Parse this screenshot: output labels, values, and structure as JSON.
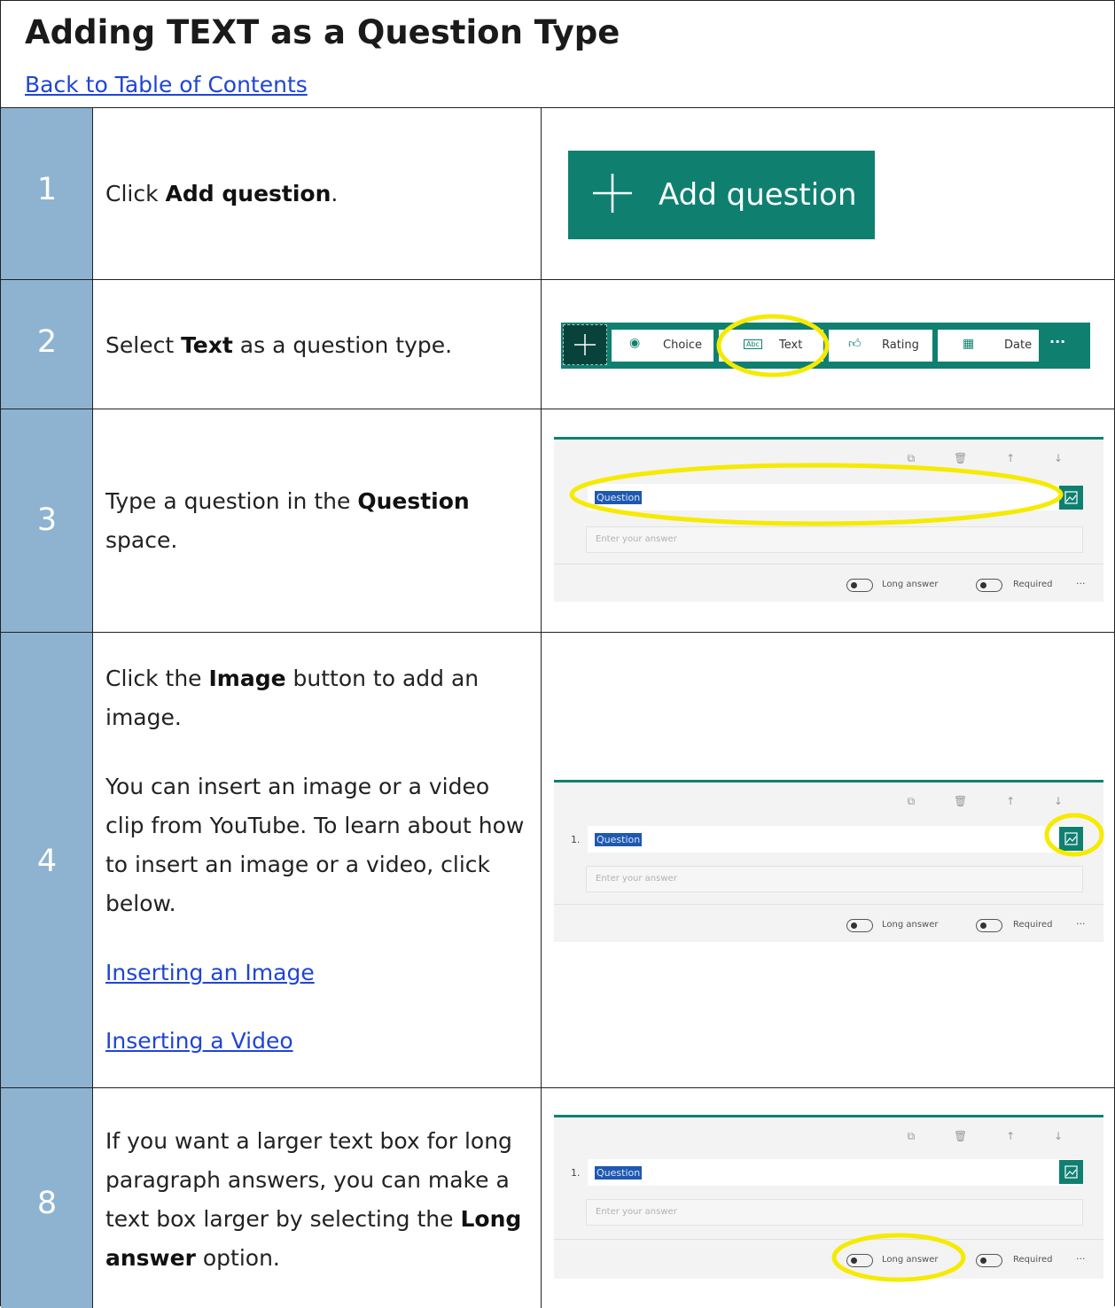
{
  "header": {
    "title": "Adding TEXT as a Question Type",
    "toc_link": "Back to Table of Contents"
  },
  "steps": [
    {
      "number": "1",
      "pre": "Click ",
      "bold": "Add question",
      "post": "."
    },
    {
      "number": "2",
      "pre": "Select ",
      "bold": "Text",
      "post": " as a question type."
    },
    {
      "number": "3",
      "pre": "Type a question in the ",
      "bold": "Question",
      "post": " space."
    },
    {
      "number": "4",
      "pre": "Click the ",
      "bold": "Image",
      "post": " button to add an image.",
      "para2": "You can insert an image or a video clip from YouTube. To learn about how to insert an image or a video, click below.",
      "link1": "Inserting an Image",
      "link2": "Inserting a Video"
    },
    {
      "number": "8",
      "pre": "If you want a larger text box for long paragraph answers, you can make a text box larger by selecting the ",
      "bold": "Long answer",
      "post": " option."
    }
  ],
  "add_question_button": {
    "label": "Add question"
  },
  "type_toolbar": {
    "choice": "Choice",
    "text": "Text",
    "text_icon": "Abc",
    "rating": "Rating",
    "date": "Date",
    "more": "···"
  },
  "form_card": {
    "question_number": "1.",
    "question_placeholder": "Question",
    "answer_placeholder": "Enter your answer",
    "long_answer": "Long answer",
    "required": "Required",
    "more": "···"
  },
  "colors": {
    "accent": "#0f8070",
    "step_bar": "#8db3d1",
    "highlight": "#f5ea00",
    "link": "#1f45d6"
  }
}
